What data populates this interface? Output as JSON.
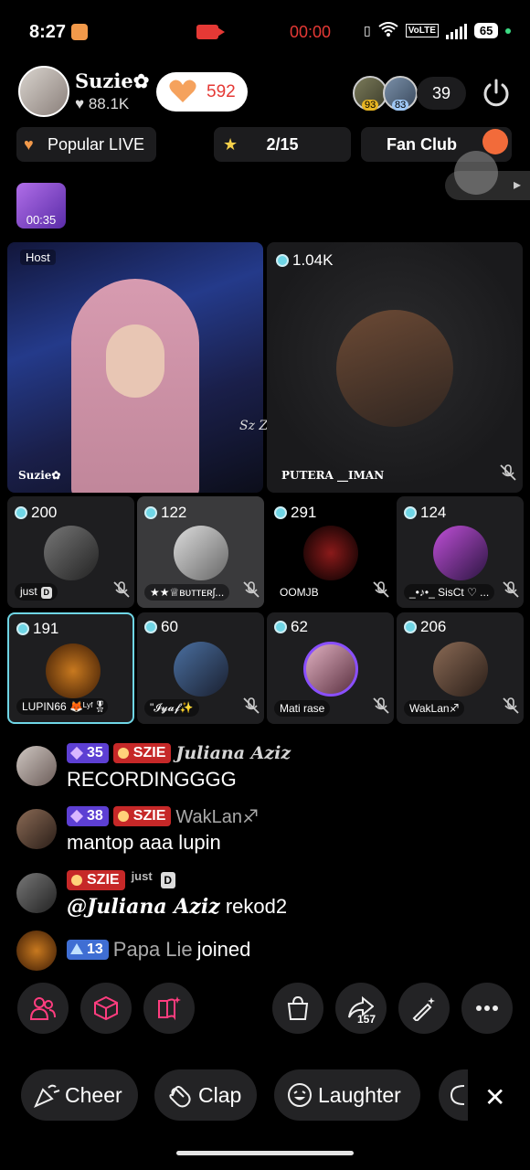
{
  "status_bar": {
    "time": "8:27",
    "record_timer": "00:00",
    "volte": "VoLTE",
    "battery": "65"
  },
  "host": {
    "name": "Suzie✿",
    "followers": "♥ 88.1K",
    "likes": "592"
  },
  "viewers": {
    "avatar1_level": "93",
    "avatar2_level": "83",
    "count": "39"
  },
  "pills": {
    "popular_live": "Popular LIVE",
    "rank": "2/15",
    "fan_club": "Fan Club"
  },
  "gift_timer": "00:35",
  "grid": {
    "host_tag": "Host",
    "host_label": "Suzie✿",
    "watermark": "Sz Zie✿",
    "guest_main": {
      "count": "1.04K",
      "name": "PUTERA __IMAN"
    },
    "guests": [
      {
        "count": "200",
        "name": "just"
      },
      {
        "count": "122",
        "name": "★★♕ʙᴜᴛᴛᴇʀʃ..."
      },
      {
        "count": "291",
        "name": "OOMJB"
      },
      {
        "count": "124",
        "name": "_•♪•_ SisCt ♡ ..."
      },
      {
        "count": "191",
        "name": "LUPIN66 🦊ᴸʸᶠ🎖"
      },
      {
        "count": "60",
        "name": "\"𝓘𝔂𝓪𝓯✨"
      },
      {
        "count": "62",
        "name": "Mati rase"
      },
      {
        "count": "206",
        "name": "WakLan♐"
      }
    ]
  },
  "chat": [
    {
      "badges": [
        "35",
        "SZIE"
      ],
      "name": "Juliana Aziz",
      "text": "RECORDINGGGG"
    },
    {
      "badges": [
        "38",
        "SZIE"
      ],
      "name": "WakLan♐",
      "text": "mantop aaa lupin"
    },
    {
      "badges": [
        "SZIE"
      ],
      "name": "just",
      "mention": "@Juliana Aziz",
      "text": "rekod2"
    },
    {
      "badges": [
        "13"
      ],
      "name": "Papa Lie",
      "text": "joined"
    }
  ],
  "toolbar": {
    "share_count": "157"
  },
  "reactions": {
    "cheer": "Cheer",
    "clap": "Clap",
    "laughter": "Laughter"
  },
  "colors": {
    "accent_red": "#e53935",
    "like_orange": "#f5a25d",
    "count_cyan": "#6fd6e6"
  }
}
